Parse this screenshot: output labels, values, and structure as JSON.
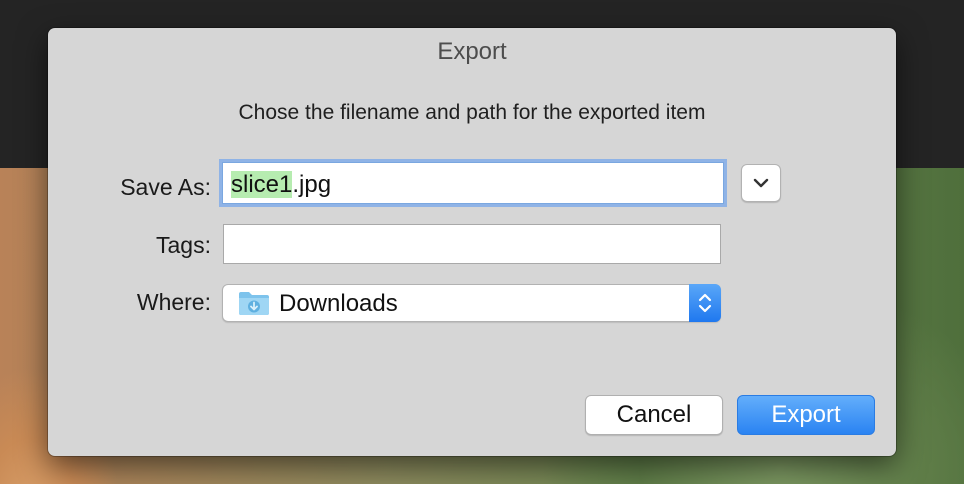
{
  "dialog": {
    "title": "Export",
    "message": "Chose the filename and path for the exported item"
  },
  "save_as": {
    "label": "Save As:",
    "value_selected": "slice1",
    "value_rest": ".jpg"
  },
  "tags": {
    "label": "Tags:",
    "value": ""
  },
  "where": {
    "label": "Where:",
    "value": "Downloads",
    "icon": "downloads-folder-icon"
  },
  "buttons": {
    "cancel": "Cancel",
    "export": "Export"
  },
  "colors": {
    "accent": "#2a83f2",
    "selection": "#b6ecb0",
    "focus_ring": "#8fb3e6"
  }
}
